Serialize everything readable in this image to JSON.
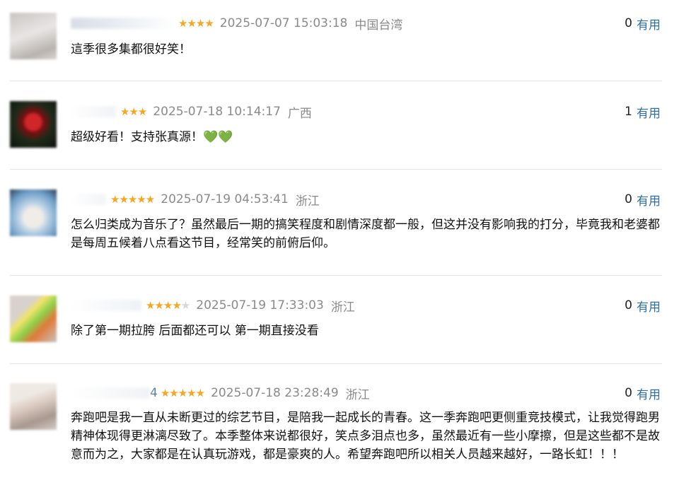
{
  "comments": [
    {
      "stars": "★★★★",
      "stars_empty": "",
      "time": "2025-07-07 15:03:18",
      "location": "中国台湾",
      "useful_count": "0",
      "useful_label": "有用",
      "text": "這季很多集都很好笑！"
    },
    {
      "stars": "★★★",
      "stars_empty": "",
      "time": "2025-07-18 10:14:17",
      "location": "广西",
      "useful_count": "1",
      "useful_label": "有用",
      "text": "超级好看！支持张真源！💚💚"
    },
    {
      "stars": "★★★★★",
      "stars_empty": "",
      "time": "2025-07-19 04:53:41",
      "location": "浙江",
      "useful_count": "0",
      "useful_label": "有用",
      "text": "怎么归类成为音乐了？虽然最后一期的搞笑程度和剧情深度都一般，但这并没有影响我的打分，毕竟我和老婆都是每周五候着八点看这节目，经常笑的前俯后仰。"
    },
    {
      "stars": "★★★★",
      "stars_empty": "★",
      "time": "2025-07-19 17:33:03",
      "location": "浙江",
      "useful_count": "0",
      "useful_label": "有用",
      "text": "除了第一期拉胯 后面都还可以 第一期直接没看"
    },
    {
      "user_suffix": "4",
      "stars": "★★★★★",
      "stars_empty": "",
      "time": "2025-07-18 23:28:49",
      "location": "浙江",
      "useful_count": "0",
      "useful_label": "有用",
      "text": "奔跑吧是我一直从未断更过的综艺节目，是陪我一起成长的青春。这一季奔跑吧更侧重竞技模式，让我觉得跑男精神体现得更淋漓尽致了。本季整体来说都很好，笑点多泪点也多，虽然最近有一些小摩擦，但是这些都不是故意而为之，大家都是在认真玩游戏，都是豪爽的人。希望奔跑吧所以相关人员越来越好，一路长虹！！！"
    }
  ],
  "colors": {
    "star": "#f5a623",
    "useful_link": "#2f6fa8",
    "meta_text": "#8a8a8a"
  }
}
